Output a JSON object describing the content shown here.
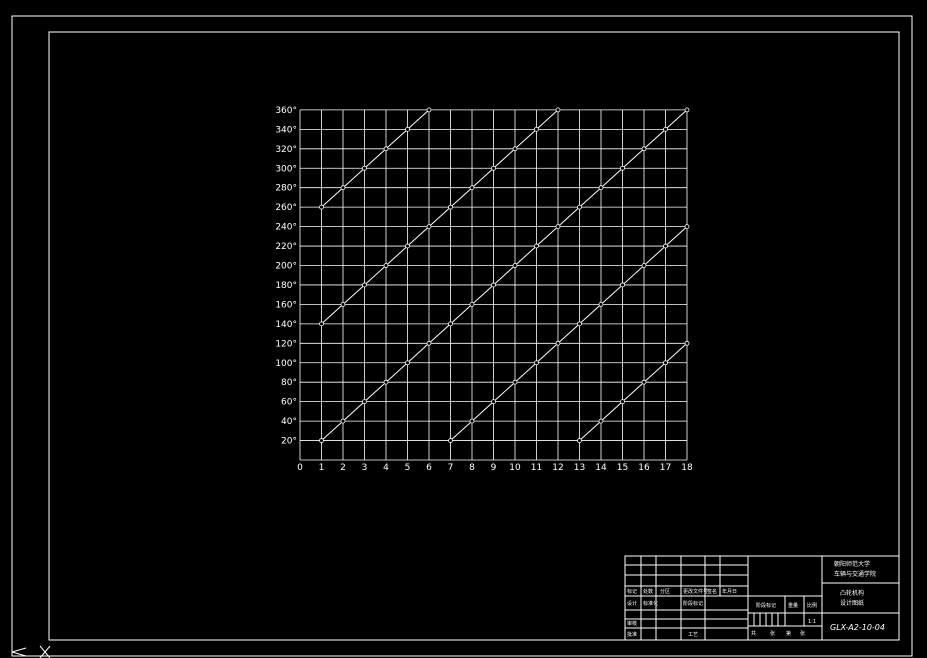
{
  "chart_data": {
    "type": "line",
    "title": "",
    "xlabel": "",
    "ylabel": "",
    "xlim": [
      0,
      18
    ],
    "ylim": [
      0,
      360
    ],
    "grid": true,
    "x_ticks": [
      "0",
      "1",
      "2",
      "3",
      "4",
      "5",
      "6",
      "7",
      "8",
      "9",
      "10",
      "11",
      "12",
      "13",
      "14",
      "15",
      "16",
      "17",
      "18"
    ],
    "y_ticks": [
      "20°",
      "40°",
      "60°",
      "80°",
      "100°",
      "120°",
      "140°",
      "160°",
      "180°",
      "200°",
      "220°",
      "240°",
      "260°",
      "280°",
      "300°",
      "320°",
      "340°",
      "360°"
    ],
    "series": [
      {
        "x": [
          1,
          2,
          3,
          4,
          5,
          6
        ],
        "y": [
          260,
          280,
          300,
          320,
          340,
          360
        ]
      },
      {
        "x": [
          1,
          2,
          3,
          4,
          5,
          6,
          7,
          8,
          9,
          10,
          11,
          12
        ],
        "y": [
          140,
          160,
          180,
          200,
          220,
          240,
          260,
          280,
          300,
          320,
          340,
          360
        ]
      },
      {
        "x": [
          1,
          2,
          3,
          4,
          5,
          6,
          7,
          8,
          9,
          10,
          11,
          12,
          13,
          14,
          15,
          16,
          17,
          18
        ],
        "y": [
          20,
          40,
          60,
          80,
          100,
          120,
          140,
          160,
          180,
          200,
          220,
          240,
          260,
          280,
          300,
          320,
          340,
          360
        ]
      },
      {
        "x": [
          7,
          8,
          9,
          10,
          11,
          12,
          13,
          14,
          15,
          16,
          17,
          18
        ],
        "y": [
          20,
          40,
          60,
          80,
          100,
          120,
          140,
          160,
          180,
          200,
          220,
          240
        ]
      },
      {
        "x": [
          13,
          14,
          15,
          16,
          17,
          18
        ],
        "y": [
          20,
          40,
          60,
          80,
          100,
          120
        ]
      }
    ]
  },
  "title_block": {
    "school_line1": "朝阳师范大学",
    "school_line2": "车辆与交通学院",
    "part_line1": "凸轮机构",
    "part_line2": "设计图纸",
    "drawing_number": "GLX-A2-10-04",
    "cells": {
      "r1c1": "标记",
      "r1c2": "处数",
      "r1c3": "分区",
      "r1c4": "更改文件号",
      "r1c5": "签名",
      "r1c6": "年月日",
      "design": "设计",
      "std": "标准化",
      "proc_stage": "阶段标记",
      "weight": "重量",
      "scale": "比例",
      "check": "审核",
      "process": "工艺",
      "approve": "批准",
      "ratio": "1:1",
      "sheet_a": "共",
      "sheet_count": "张",
      "sheet_b": "第",
      "sheet_no": "张"
    }
  }
}
